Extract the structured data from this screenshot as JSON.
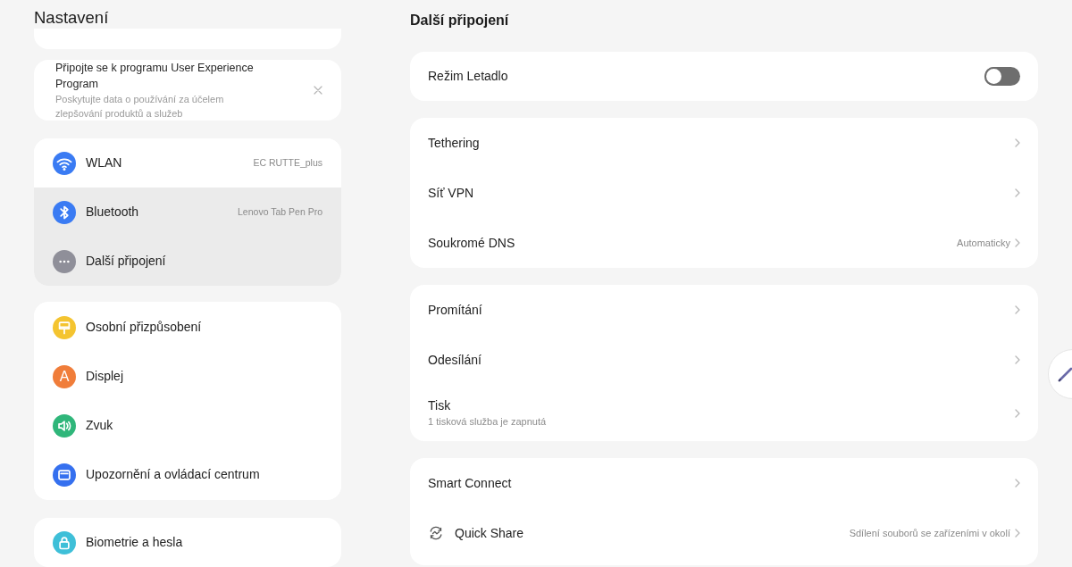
{
  "sidebar": {
    "title": "Nastavení",
    "banner": {
      "title": "Připojte se k programu User Experience Program",
      "description": "Poskytujte data o používání za účelem zlepšování produktů a služeb"
    },
    "groups": [
      {
        "items": [
          {
            "label": "WLAN",
            "value": "EC RUTTE_plus",
            "color": "#3a7bf3",
            "selected": false
          },
          {
            "label": "Bluetooth",
            "value": "Lenovo Tab Pen Pro",
            "color": "#3a7bf3",
            "selected": true
          },
          {
            "label": "Další připojení",
            "color": "#8f8f99",
            "selected": true
          }
        ]
      },
      {
        "items": [
          {
            "label": "Osobní přizpůsobení",
            "color": "#f4c430",
            "selected": false
          },
          {
            "label": "Displej",
            "color": "#f07d3a",
            "glyph": "A",
            "selected": false
          },
          {
            "label": "Zvuk",
            "color": "#2fb67a",
            "selected": false
          },
          {
            "label": "Upozornění a ovládací centrum",
            "color": "#3570ef",
            "selected": false
          }
        ]
      },
      {
        "items": [
          {
            "label": "Biometrie a hesla",
            "color": "#3ebfd8",
            "selected": false
          }
        ]
      }
    ]
  },
  "detail": {
    "title": "Další připojení",
    "groups": [
      {
        "items": [
          {
            "kind": "toggle",
            "label": "Režim Letadlo",
            "on": false
          }
        ]
      },
      {
        "items": [
          {
            "kind": "link",
            "label": "Tethering"
          },
          {
            "kind": "link",
            "label": "Síť VPN"
          },
          {
            "kind": "link",
            "label": "Soukromé DNS",
            "value": "Automaticky"
          }
        ]
      },
      {
        "items": [
          {
            "kind": "link",
            "label": "Promítání"
          },
          {
            "kind": "link",
            "label": "Odesílání"
          },
          {
            "kind": "link",
            "label": "Tisk",
            "subtitle": "1 tisková služba je zapnutá"
          }
        ]
      },
      {
        "items": [
          {
            "kind": "link",
            "label": "Smart Connect"
          },
          {
            "kind": "icon_link",
            "label": "Quick Share",
            "value": "Sdílení souborů se zařízeními v okolí"
          }
        ]
      }
    ]
  }
}
